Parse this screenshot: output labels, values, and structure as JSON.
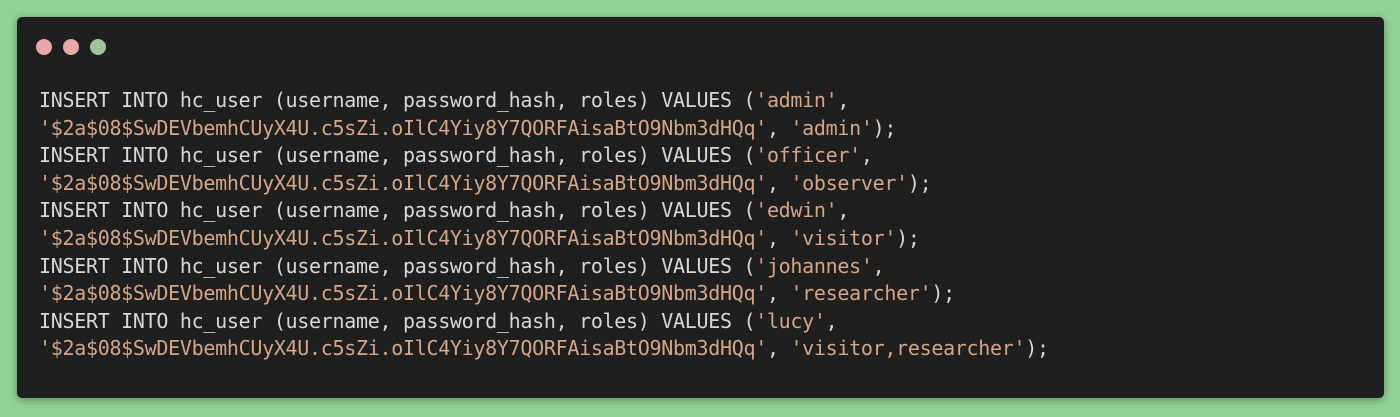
{
  "window": {
    "controls": [
      {
        "name": "close",
        "color": "#e9a6a6"
      },
      {
        "name": "minimize",
        "color": "#e9a6a6"
      },
      {
        "name": "maximize",
        "color": "#9ec39a"
      }
    ]
  },
  "colors": {
    "background": "#90d196",
    "editor": "#1f1f1f",
    "text": "#d7d7d7",
    "string": "#d3a689"
  },
  "code": {
    "lines": [
      {
        "a": "INSERT INTO hc_user (username, password_hash, roles) VALUES (",
        "b": "'admin'",
        "c": ","
      },
      {
        "a": "",
        "b": "'$2a$08$SwDEVbemhCUyX4U.c5sZi.oIlC4Yiy8Y7QORFAisaBtO9Nbm3dHQq'",
        "c": ", ",
        "d": "'admin'",
        "e": ");"
      },
      {
        "a": "INSERT INTO hc_user (username, password_hash, roles) VALUES (",
        "b": "'officer'",
        "c": ","
      },
      {
        "a": "",
        "b": "'$2a$08$SwDEVbemhCUyX4U.c5sZi.oIlC4Yiy8Y7QORFAisaBtO9Nbm3dHQq'",
        "c": ", ",
        "d": "'observer'",
        "e": ");"
      },
      {
        "a": "INSERT INTO hc_user (username, password_hash, roles) VALUES (",
        "b": "'edwin'",
        "c": ","
      },
      {
        "a": "",
        "b": "'$2a$08$SwDEVbemhCUyX4U.c5sZi.oIlC4Yiy8Y7QORFAisaBtO9Nbm3dHQq'",
        "c": ", ",
        "d": "'visitor'",
        "e": ");"
      },
      {
        "a": "INSERT INTO hc_user (username, password_hash, roles) VALUES (",
        "b": "'johannes'",
        "c": ","
      },
      {
        "a": "",
        "b": "'$2a$08$SwDEVbemhCUyX4U.c5sZi.oIlC4Yiy8Y7QORFAisaBtO9Nbm3dHQq'",
        "c": ", ",
        "d": "'researcher'",
        "e": ");"
      },
      {
        "a": "INSERT INTO hc_user (username, password_hash, roles) VALUES (",
        "b": "'lucy'",
        "c": ","
      },
      {
        "a": "",
        "b": "'$2a$08$SwDEVbemhCUyX4U.c5sZi.oIlC4Yiy8Y7QORFAisaBtO9Nbm3dHQq'",
        "c": ", ",
        "d": "'visitor,researcher'",
        "e": ");"
      }
    ]
  }
}
